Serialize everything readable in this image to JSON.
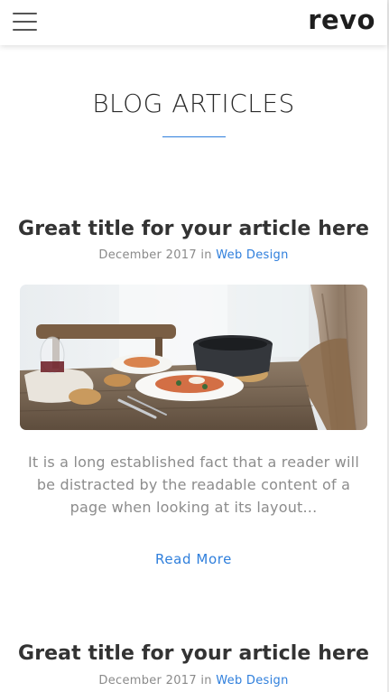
{
  "header": {
    "menu_icon": "hamburger-menu-icon",
    "logo_text": "revo"
  },
  "section": {
    "title": "BLOG ARTICLES",
    "accent_color": "#2f7fdc"
  },
  "articles": [
    {
      "title": "Great title for your article here",
      "date": "December 2017",
      "in_text": "in",
      "category": "Web Design",
      "image": "dining-table-photo",
      "excerpt": "It is a long established fact that a reader will be distracted by the readable content of a page when looking at its layout...",
      "read_more": "Read More"
    },
    {
      "title": "Great title for your article here",
      "date": "December 2017",
      "in_text": "in",
      "category": "Web Design"
    }
  ]
}
